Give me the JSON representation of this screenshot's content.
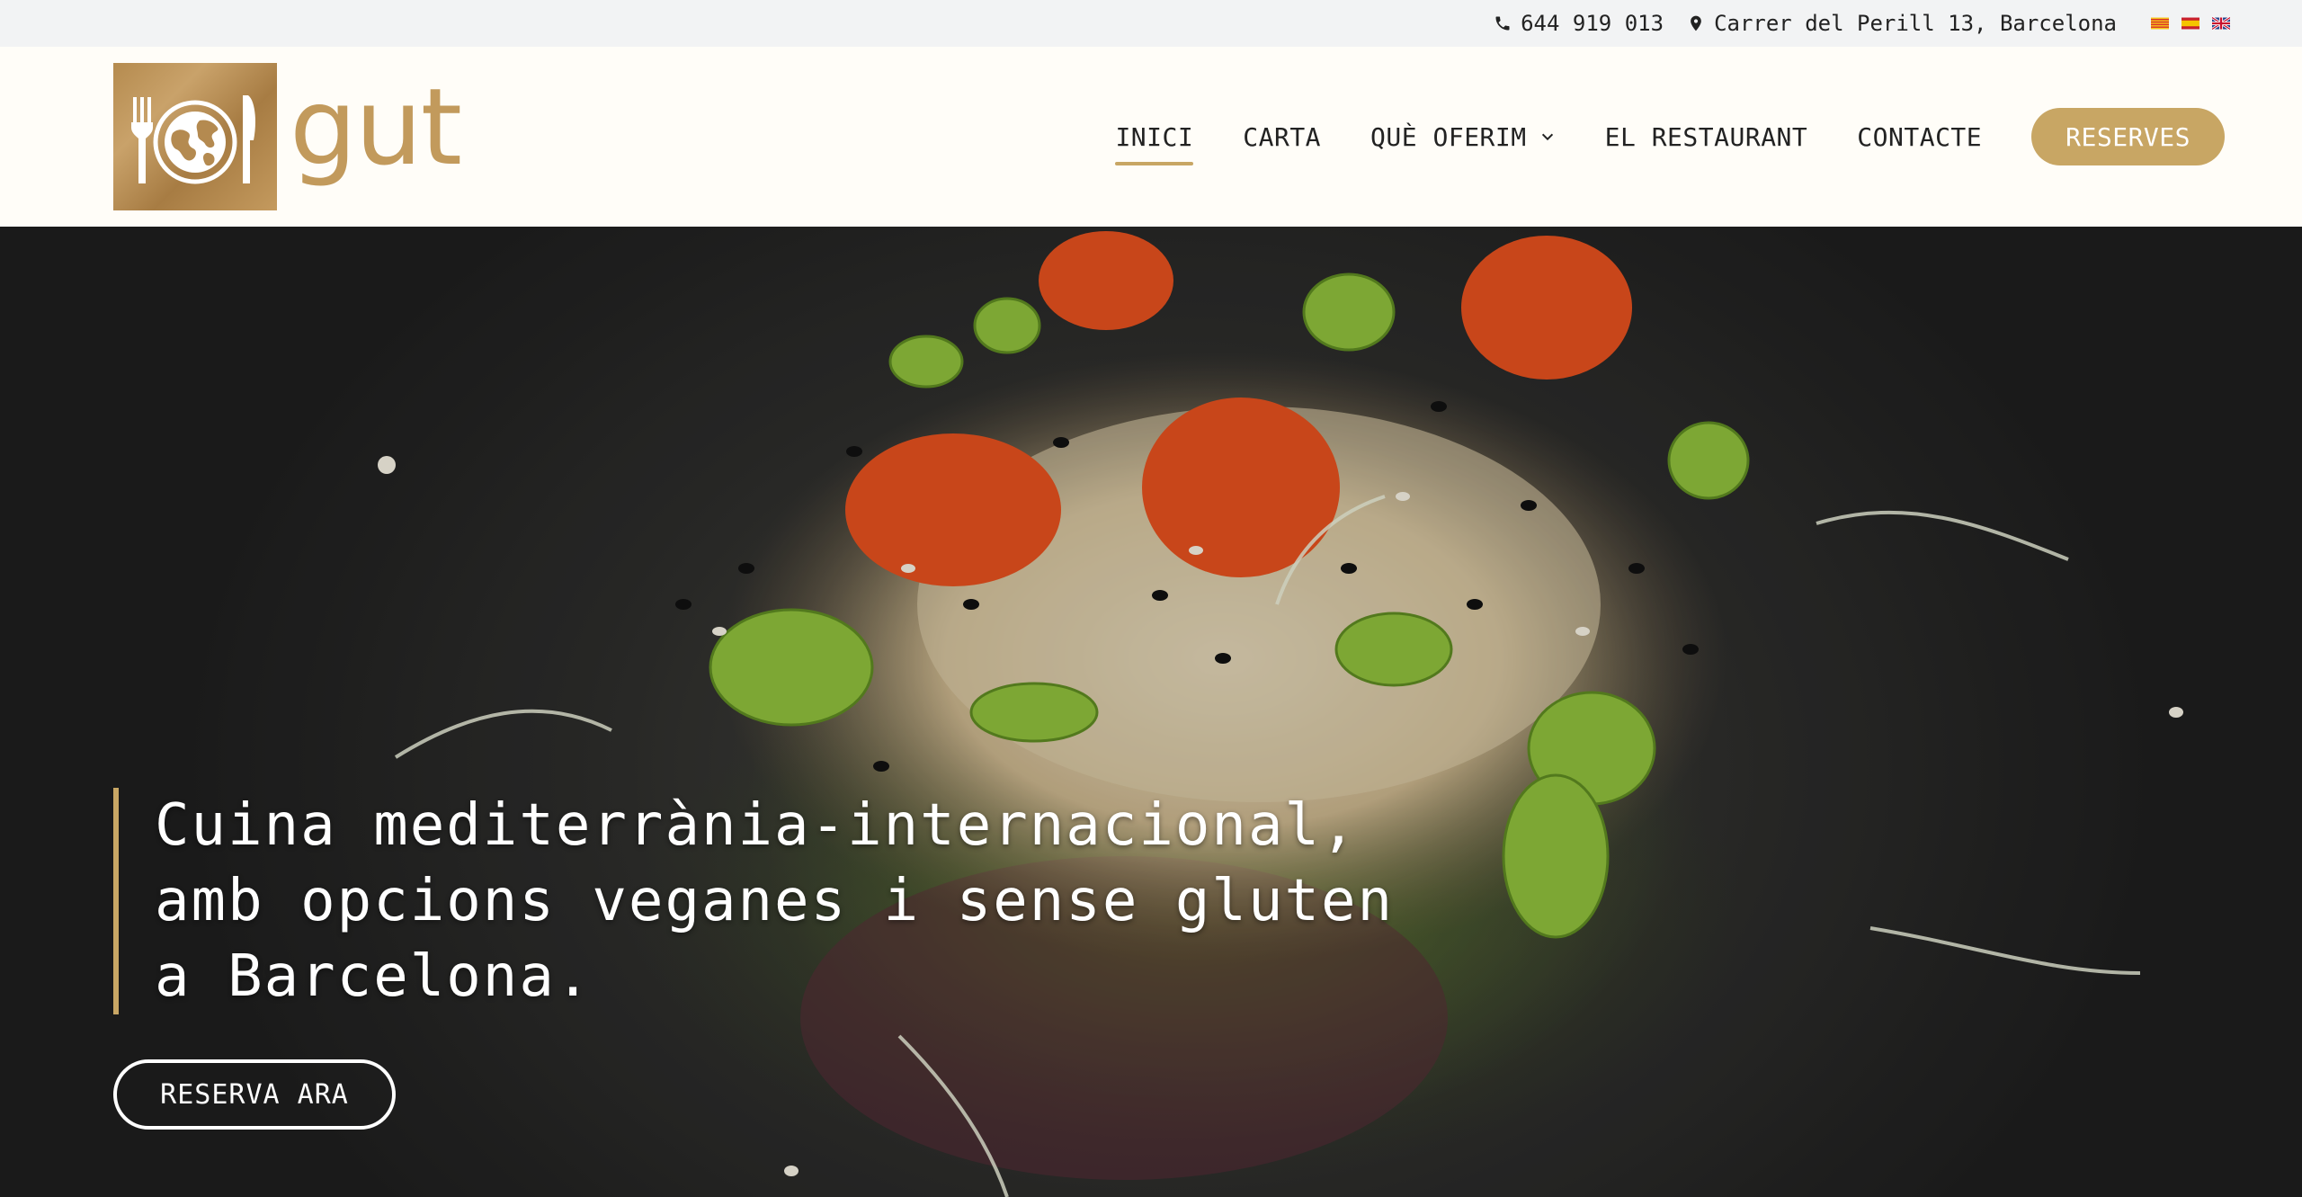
{
  "topbar": {
    "phone": "644 919 013",
    "address": "Carrer del Perill 13, Barcelona",
    "phone_icon": "phone-icon",
    "location_icon": "map-pin-icon",
    "languages": [
      {
        "code": "ca",
        "icon": "catalan-flag-icon"
      },
      {
        "code": "es",
        "icon": "spanish-flag-icon"
      },
      {
        "code": "en",
        "icon": "uk-flag-icon"
      }
    ]
  },
  "header": {
    "logo_text": "gut",
    "nav": [
      {
        "label": "INICI",
        "active": true
      },
      {
        "label": "CARTA",
        "active": false
      },
      {
        "label": "QUÈ OFERIM",
        "active": false,
        "dropdown": true
      },
      {
        "label": "EL RESTAURANT",
        "active": false
      },
      {
        "label": "CONTACTE",
        "active": false
      }
    ],
    "reserve_label": "RESERVES"
  },
  "hero": {
    "tagline_lines": [
      "Cuina mediterrània-internacional,",
      "amb opcions veganes i sense gluten",
      "a Barcelona."
    ],
    "cta_label": "RESERVA ARA"
  },
  "colors": {
    "accent": "#c8a664",
    "logo_gold": "#c29a5c",
    "header_bg": "#fffdf8",
    "topbar_bg": "#f2f3f4"
  }
}
